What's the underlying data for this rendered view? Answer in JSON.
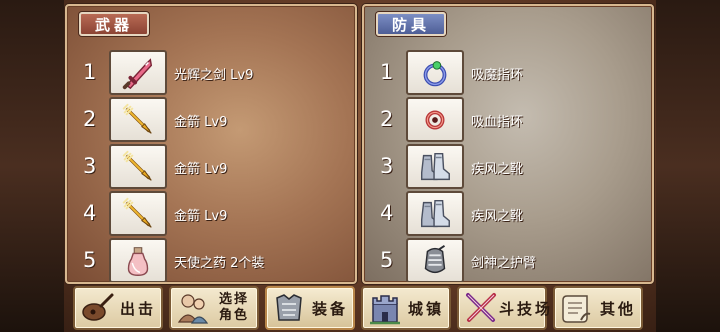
{
  "weapons": {
    "title": "武器",
    "items": [
      {
        "num": "1",
        "name": "光辉之剑 Lv9",
        "icon": "sword-icon"
      },
      {
        "num": "2",
        "name": "金箭 Lv9",
        "icon": "golden-arrow-icon"
      },
      {
        "num": "3",
        "name": "金箭 Lv9",
        "icon": "golden-arrow-icon"
      },
      {
        "num": "4",
        "name": "金箭 Lv9",
        "icon": "golden-arrow-icon"
      },
      {
        "num": "5",
        "name": "天使之药 2个装",
        "icon": "potion-bottle-icon"
      }
    ]
  },
  "armor": {
    "title": "防具",
    "items": [
      {
        "num": "1",
        "name": "吸魔指环",
        "icon": "blue-ring-icon"
      },
      {
        "num": "2",
        "name": "吸血指环",
        "icon": "red-ring-icon"
      },
      {
        "num": "3",
        "name": "疾风之靴",
        "icon": "boots-icon"
      },
      {
        "num": "4",
        "name": "疾风之靴",
        "icon": "boots-icon"
      },
      {
        "num": "5",
        "name": "剑神之护臂",
        "icon": "gauntlet-icon"
      }
    ]
  },
  "nav": {
    "sortie": "出击",
    "choose_line1": "选择",
    "choose_line2": "角色",
    "equip": "装备",
    "town": "城镇",
    "arena": "斗技场",
    "other": "其他"
  },
  "colors": {
    "weapons_accent": "#a85a44",
    "armor_accent": "#5e70aa",
    "slot_bg": "#f4f0e8",
    "button_bg": "#ecdcb8"
  }
}
